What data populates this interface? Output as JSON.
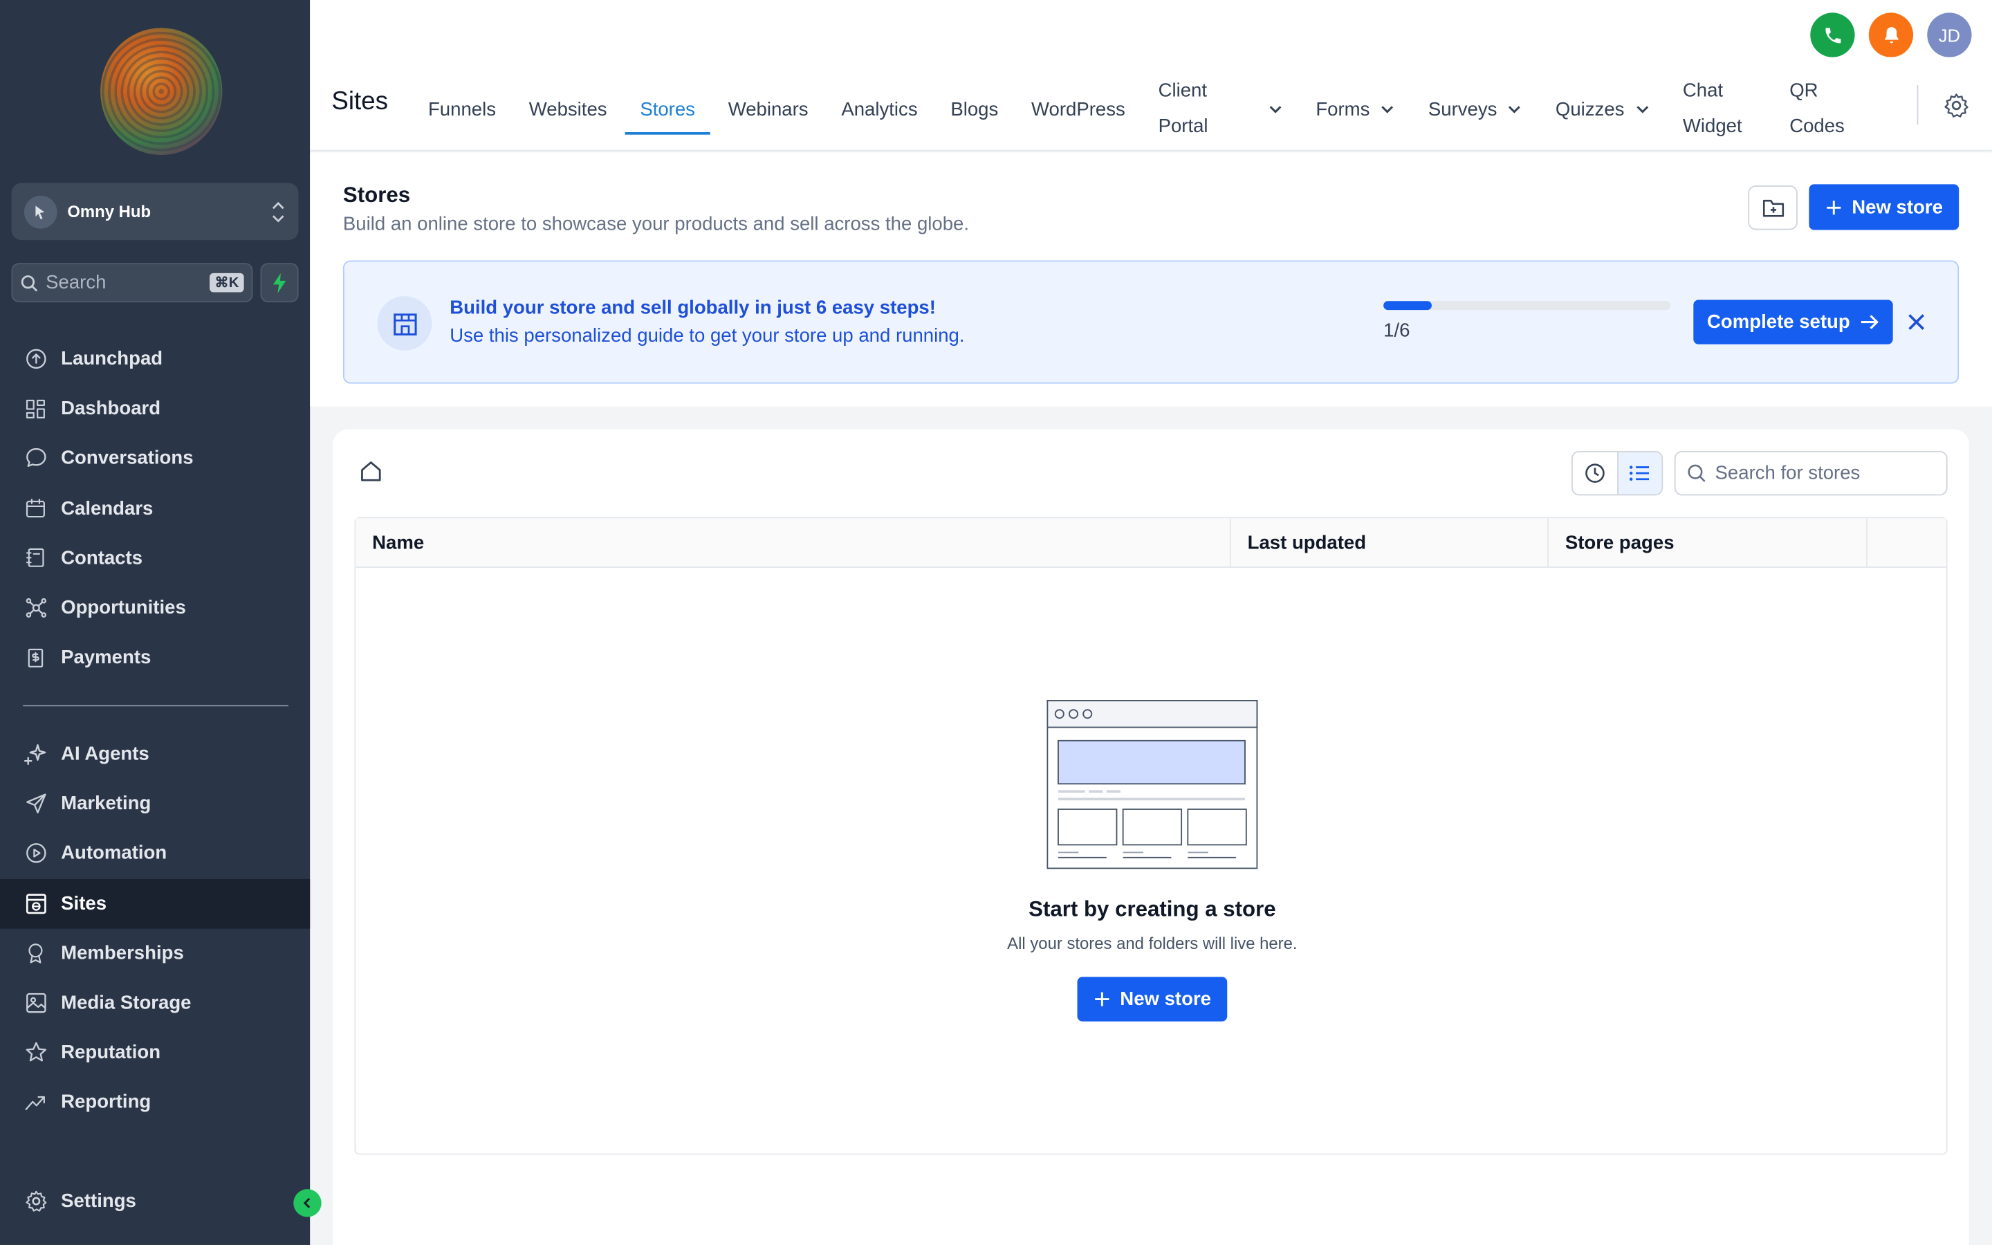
{
  "sidebar": {
    "account_name": "Omny Hub",
    "search_label": "Search",
    "search_shortcut": "⌘K",
    "nav_primary": [
      {
        "label": "Launchpad",
        "icon": "launchpad-icon"
      },
      {
        "label": "Dashboard",
        "icon": "dashboard-icon"
      },
      {
        "label": "Conversations",
        "icon": "chat-bubble-icon"
      },
      {
        "label": "Calendars",
        "icon": "calendar-icon"
      },
      {
        "label": "Contacts",
        "icon": "contacts-icon"
      },
      {
        "label": "Opportunities",
        "icon": "opportunities-icon"
      },
      {
        "label": "Payments",
        "icon": "payments-icon"
      }
    ],
    "nav_secondary": [
      {
        "label": "AI Agents",
        "icon": "sparkle-icon"
      },
      {
        "label": "Marketing",
        "icon": "send-icon"
      },
      {
        "label": "Automation",
        "icon": "automation-icon"
      },
      {
        "label": "Sites",
        "icon": "sites-icon",
        "active": true
      },
      {
        "label": "Memberships",
        "icon": "badge-icon"
      },
      {
        "label": "Media Storage",
        "icon": "image-icon"
      },
      {
        "label": "Reputation",
        "icon": "star-icon"
      },
      {
        "label": "Reporting",
        "icon": "trend-icon"
      }
    ],
    "settings_label": "Settings"
  },
  "header": {
    "section_title": "Sites",
    "avatar_initials": "JD",
    "tabs": [
      {
        "label": "Funnels"
      },
      {
        "label": "Websites"
      },
      {
        "label": "Stores",
        "active": true
      },
      {
        "label": "Webinars"
      },
      {
        "label": "Analytics"
      },
      {
        "label": "Blogs"
      },
      {
        "label": "WordPress"
      },
      {
        "label": "Client Portal",
        "dropdown": true
      },
      {
        "label": "Forms",
        "dropdown": true
      },
      {
        "label": "Surveys",
        "dropdown": true
      },
      {
        "label": "Quizzes",
        "dropdown": true
      },
      {
        "label": "Chat Widget"
      },
      {
        "label": "QR Codes"
      }
    ]
  },
  "page": {
    "title": "Stores",
    "subtitle": "Build an online store to showcase your products and sell across the globe.",
    "new_store_label": "New store"
  },
  "banner": {
    "title": "Build your store and sell globally in just 6 easy steps!",
    "subtitle": "Use this personalized guide to get your store up and running.",
    "progress_label": "1/6",
    "progress_fraction": 0.1667,
    "button_label": "Complete setup"
  },
  "list": {
    "search_placeholder": "Search for stores",
    "columns": {
      "name": "Name",
      "last_updated": "Last updated",
      "store_pages": "Store pages"
    },
    "empty_title": "Start by creating a store",
    "empty_subtitle": "All your stores and folders will live here.",
    "empty_button_label": "New store"
  },
  "colors": {
    "primary": "#155eef",
    "sidebar_bg": "#2a3547",
    "active_tab": "#1d7fd6",
    "phone": "#16a34a",
    "bell": "#f97316"
  }
}
